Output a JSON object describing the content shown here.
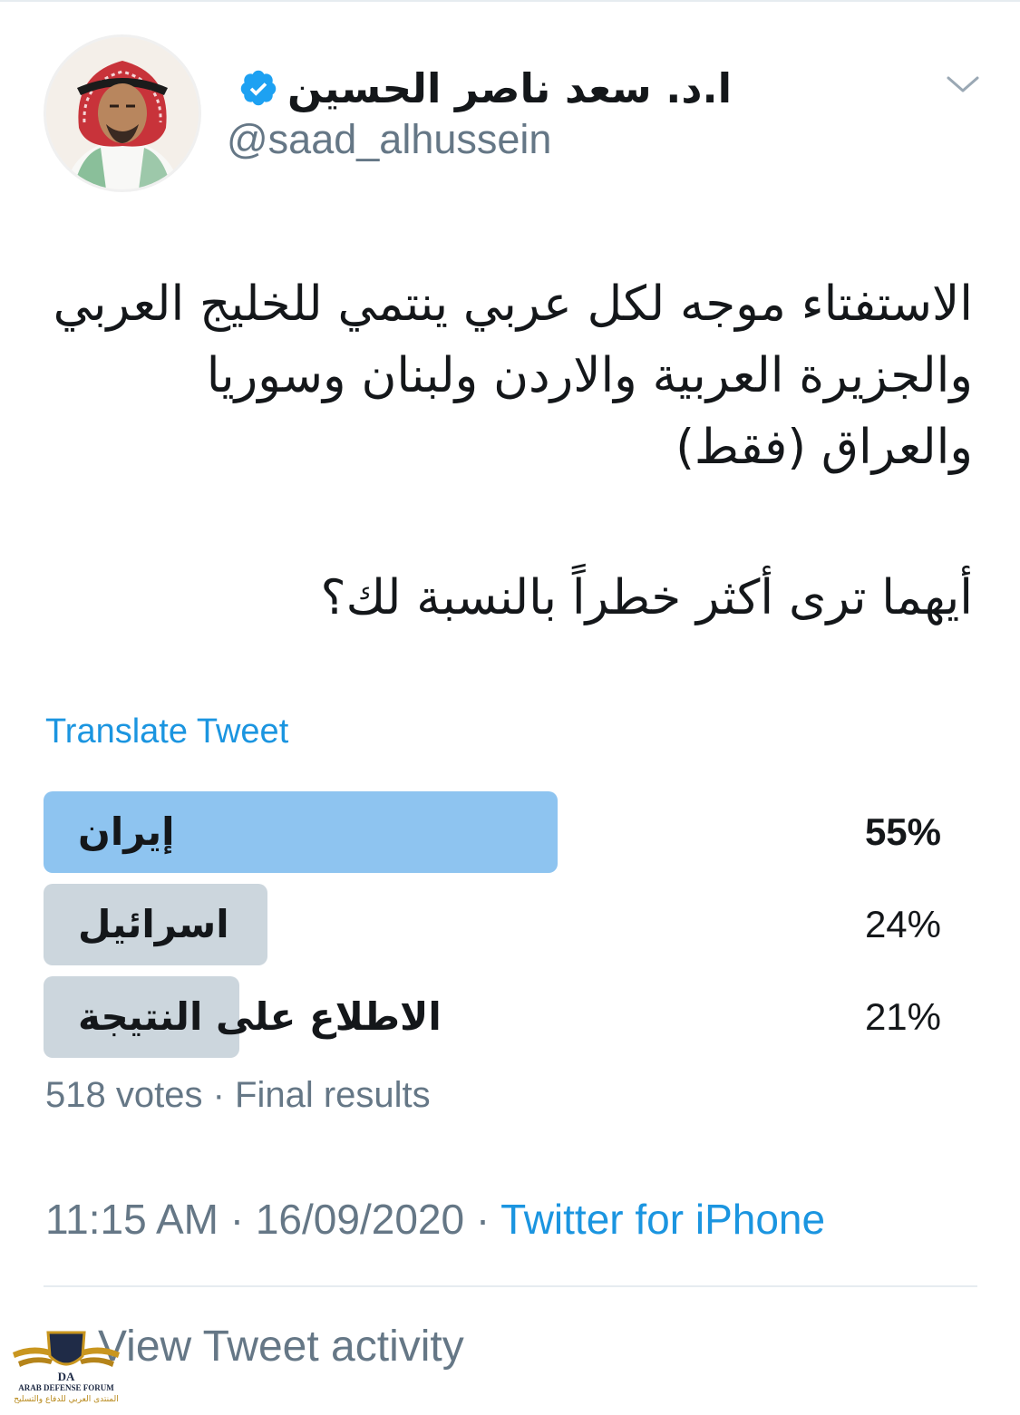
{
  "author": {
    "display_name": "ا.د. سعد ناصر الحسين",
    "handle": "@saad_alhussein",
    "verified": true
  },
  "tweet": {
    "text": "الاستفتاء موجه لكل عربي ينتمي للخليج العربي والجزيرة العربية والاردن ولبنان وسوريا والعراق (فقط)",
    "question": "أيهما ترى أكثر خطراً بالنسبة لك؟",
    "translate_label": "Translate Tweet"
  },
  "poll": {
    "options": [
      {
        "label": "إيران",
        "percent_text": "55%",
        "fraction": 0.55,
        "leading": true
      },
      {
        "label": "اسرائيل",
        "percent_text": "24%",
        "fraction": 0.24,
        "leading": false
      },
      {
        "label": "الاطلاع على النتيجة",
        "percent_text": "21%",
        "fraction": 0.21,
        "leading": false
      }
    ],
    "votes": "518 votes",
    "status": "Final results"
  },
  "meta": {
    "time": "11:15 AM",
    "date": "16/09/2020",
    "source": "Twitter for iPhone",
    "separator": "·"
  },
  "activity_label": "View Tweet activity",
  "watermark": {
    "logo_text": "DA",
    "name_en": "ARAB DEFENSE FORUM",
    "name_ar": "المنتدى العربي للدفاع والتسليح"
  },
  "colors": {
    "link_blue": "#1b95e0",
    "leading_bar": "#8ec4f0",
    "other_bar": "#ccd6dd",
    "secondary_text": "#657786"
  },
  "icons": {
    "verified": "verified-badge-icon",
    "more": "chevron-down-icon"
  }
}
